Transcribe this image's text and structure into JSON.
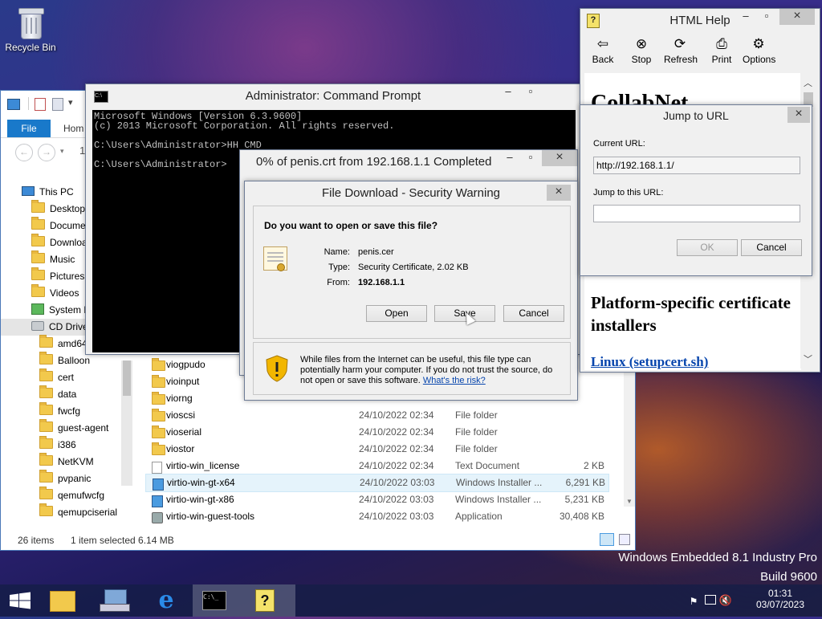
{
  "desktop": {
    "recycle_bin_label": "Recycle Bin",
    "watermark_line1": "Windows Embedded 8.1 Industry Pro",
    "watermark_line2": "Build 9600"
  },
  "explorer": {
    "ribbon_file": "File",
    "ribbon_home": "Hom",
    "nav_partial": "1",
    "tree": [
      {
        "label": "This PC",
        "icon": "pc-icon",
        "indent": 0
      },
      {
        "label": "Desktop",
        "icon": "folder-icon",
        "indent": 1
      },
      {
        "label": "Docume",
        "icon": "folder-icon",
        "indent": 1
      },
      {
        "label": "Downloa",
        "icon": "folder-icon",
        "indent": 1
      },
      {
        "label": "Music",
        "icon": "folder-icon",
        "indent": 1
      },
      {
        "label": "Pictures",
        "icon": "folder-icon",
        "indent": 1
      },
      {
        "label": "Videos",
        "icon": "folder-icon",
        "indent": 1
      },
      {
        "label": "System R",
        "icon": "system-drive-icon",
        "indent": 1
      },
      {
        "label": "CD Drive",
        "icon": "cd-drive-icon",
        "indent": 1
      },
      {
        "label": "amd64",
        "icon": "folder-icon",
        "indent": 2
      },
      {
        "label": "Balloon",
        "icon": "folder-icon",
        "indent": 2
      },
      {
        "label": "cert",
        "icon": "folder-icon",
        "indent": 2
      },
      {
        "label": "data",
        "icon": "folder-icon",
        "indent": 2
      },
      {
        "label": "fwcfg",
        "icon": "folder-icon",
        "indent": 2
      },
      {
        "label": "guest-agent",
        "icon": "folder-icon",
        "indent": 2
      },
      {
        "label": "i386",
        "icon": "folder-icon",
        "indent": 2
      },
      {
        "label": "NetKVM",
        "icon": "folder-icon",
        "indent": 2
      },
      {
        "label": "pvpanic",
        "icon": "folder-icon",
        "indent": 2
      },
      {
        "label": "qemufwcfg",
        "icon": "folder-icon",
        "indent": 2
      },
      {
        "label": "qemupciserial",
        "icon": "folder-icon",
        "indent": 2
      }
    ],
    "files": [
      {
        "name": "viogpudo",
        "date": "",
        "type": "",
        "size": "",
        "icon": "folder-icon"
      },
      {
        "name": "vioinput",
        "date": "",
        "type": "",
        "size": "",
        "icon": "folder-icon"
      },
      {
        "name": "viorng",
        "date": "",
        "type": "",
        "size": "",
        "icon": "folder-icon"
      },
      {
        "name": "vioscsi",
        "date": "24/10/2022 02:34",
        "type": "File folder",
        "size": "",
        "icon": "folder-icon"
      },
      {
        "name": "vioserial",
        "date": "24/10/2022 02:34",
        "type": "File folder",
        "size": "",
        "icon": "folder-icon"
      },
      {
        "name": "viostor",
        "date": "24/10/2022 02:34",
        "type": "File folder",
        "size": "",
        "icon": "folder-icon"
      },
      {
        "name": "virtio-win_license",
        "date": "24/10/2022 02:34",
        "type": "Text Document",
        "size": "2 KB",
        "icon": "text-file-icon"
      },
      {
        "name": "virtio-win-gt-x64",
        "date": "24/10/2022 03:03",
        "type": "Windows Installer ...",
        "size": "6,291 KB",
        "icon": "installer-icon",
        "selected": true
      },
      {
        "name": "virtio-win-gt-x86",
        "date": "24/10/2022 03:03",
        "type": "Windows Installer ...",
        "size": "5,231 KB",
        "icon": "installer-icon"
      },
      {
        "name": "virtio-win-guest-tools",
        "date": "24/10/2022 03:03",
        "type": "Application",
        "size": "30,408 KB",
        "icon": "application-icon"
      }
    ],
    "status_items": "26 items",
    "status_selected": "1 item selected  6.14 MB"
  },
  "cmd": {
    "title": "Administrator: Command Prompt",
    "lines": [
      "Microsoft Windows [Version 6.3.9600]",
      "(c) 2013 Microsoft Corporation. All rights reserved.",
      "",
      "C:\\Users\\Administrator>HH CMD",
      "",
      "C:\\Users\\Administrator>"
    ]
  },
  "download": {
    "title": "0% of penis.crt from 192.168.1.1 Completed"
  },
  "security": {
    "title": "File Download - Security Warning",
    "question": "Do you want to open or save this file?",
    "name_label": "Name:",
    "name_value": "penis.cer",
    "type_label": "Type:",
    "type_value": "Security Certificate, 2.02 KB",
    "from_label": "From:",
    "from_value": "192.168.1.1",
    "open_btn": "Open",
    "save_btn": "Save",
    "cancel_btn": "Cancel",
    "warning_text": "While files from the Internet can be useful, this file type can potentially harm your computer. If you do not trust the source, do not open or save this software.",
    "risk_link": "What's the risk?"
  },
  "help": {
    "title": "HTML Help",
    "toolbar": [
      {
        "label": "Back",
        "icon": "back-arrow-icon"
      },
      {
        "label": "Stop",
        "icon": "stop-icon"
      },
      {
        "label": "Refresh",
        "icon": "refresh-icon"
      },
      {
        "label": "Print",
        "icon": "print-icon"
      },
      {
        "label": "Options",
        "icon": "options-icon"
      }
    ],
    "heading1": "CollabNet",
    "heading2": "Platform-specific certificate installers",
    "link": "Linux (setupcert.sh)"
  },
  "jump": {
    "title": "Jump to URL",
    "current_label": "Current URL:",
    "current_value": "http://192.168.1.1/",
    "jump_label": "Jump to this URL:",
    "jump_value": "",
    "ok_btn": "OK",
    "cancel_btn": "Cancel"
  },
  "taskbar": {
    "time": "01:31",
    "date": "03/07/2023"
  },
  "colors": {
    "accent": "#1979ca",
    "link": "#0645ad",
    "console_bg": "#000000",
    "console_fg": "#c0c0c0"
  }
}
